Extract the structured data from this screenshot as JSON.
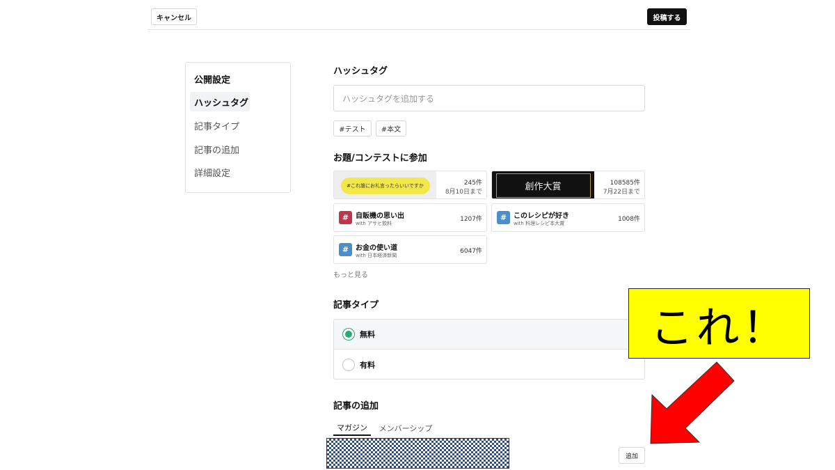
{
  "header": {
    "cancel_label": "キャンセル",
    "post_label": "投稿する"
  },
  "sidebar": {
    "title": "公開設定",
    "items": [
      {
        "label": "ハッシュタグ",
        "active": true
      },
      {
        "label": "記事タイプ",
        "active": false
      },
      {
        "label": "記事の追加",
        "active": false
      },
      {
        "label": "詳細設定",
        "active": false
      }
    ]
  },
  "hashtags": {
    "heading": "ハッシュタグ",
    "placeholder": "ハッシュタグを追加する",
    "chips": [
      "#テスト",
      "#本文"
    ]
  },
  "contests": {
    "heading": "お題/コンテストに参加",
    "banners": [
      {
        "banner_text": "#これ誰にお礼言ったらいいですか",
        "count": "245件",
        "deadline": "8月10日まで"
      },
      {
        "banner_text": "創作大賞",
        "count": "108585件",
        "deadline": "7月22日まで"
      }
    ],
    "topics": [
      {
        "title": "自販機の思い出",
        "sponsor": "with アサヒ飲料",
        "count": "1207件",
        "color": "#c0354a"
      },
      {
        "title": "このレシピが好き",
        "sponsor": "with 料理レシピ本大賞",
        "count": "1008件",
        "color": "#4a8fc9"
      },
      {
        "title": "お金の使い道",
        "sponsor": "with 日本経済新聞",
        "count": "6047件",
        "color": "#4a8fc9"
      }
    ],
    "more_label": "もっと見る"
  },
  "article_type": {
    "heading": "記事タイプ",
    "options": [
      {
        "label": "無料",
        "selected": true
      },
      {
        "label": "有料",
        "selected": false
      }
    ]
  },
  "article_add": {
    "heading": "記事の追加",
    "tabs": [
      {
        "label": "マガジン",
        "active": true
      },
      {
        "label": "メンバーシップ",
        "active": false
      }
    ],
    "add_label": "追加"
  },
  "annotation": {
    "callout_text": "これ！",
    "arrow_color": "#ff0000",
    "callout_color": "#ffff00"
  }
}
